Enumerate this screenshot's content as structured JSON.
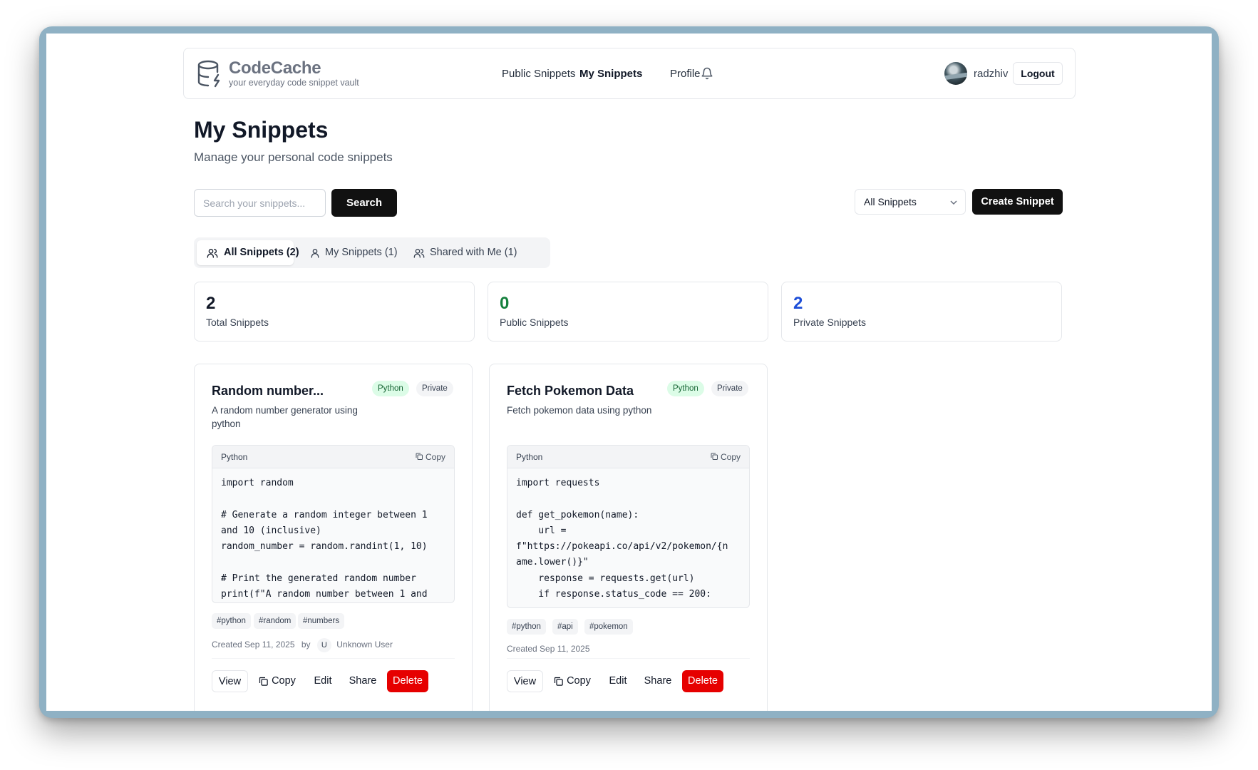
{
  "app": {
    "name": "CodeCache",
    "tagline": "your everyday code snippet vault"
  },
  "nav": {
    "links": [
      "Public Snippets",
      "My Snippets",
      "Profile"
    ],
    "active": "My Snippets",
    "username": "radzhiv",
    "logout_label": "Logout"
  },
  "header": {
    "title": "My Snippets",
    "subtitle": "Manage your personal code snippets"
  },
  "toolbar": {
    "search_placeholder": "Search your snippets...",
    "search_label": "Search",
    "filter_value": "All Snippets",
    "create_label": "Create Snippet"
  },
  "tabs": [
    {
      "label": "All Snippets (2)",
      "active": true
    },
    {
      "label": "My Snippets (1)",
      "active": false
    },
    {
      "label": "Shared with Me (1)",
      "active": false
    }
  ],
  "stats": [
    {
      "value": "2",
      "label": "Total Snippets",
      "color": "#111827"
    },
    {
      "value": "0",
      "label": "Public Snippets",
      "color": "#15803d"
    },
    {
      "value": "2",
      "label": "Private Snippets",
      "color": "#1d4ed8"
    }
  ],
  "snippets": [
    {
      "title": "Random number...",
      "language": "Python",
      "visibility": "Private",
      "description": "A random number generator using python",
      "code_language": "Python",
      "copy_label": "Copy",
      "code": "import random\n\n# Generate a random integer between 1\nand 10 (inclusive)\nrandom_number = random.randint(1, 10)\n\n# Print the generated random number\nprint(f\"A random number between 1 and",
      "tags": [
        "#python",
        "#random",
        "#numbers"
      ],
      "created": "Created Sep 11, 2025",
      "by_label": "by",
      "author_initial": "U",
      "author": "Unknown User",
      "actions": {
        "view": "View",
        "copy": "Copy",
        "edit": "Edit",
        "share": "Share",
        "delete": "Delete"
      }
    },
    {
      "title": "Fetch Pokemon Data",
      "language": "Python",
      "visibility": "Private",
      "description": "Fetch pokemon data using python",
      "code_language": "Python",
      "copy_label": "Copy",
      "code": "import requests\n\ndef get_pokemon(name):\n    url =\nf\"https://pokeapi.co/api/v2/pokemon/{n\name.lower()}\"\n    response = requests.get(url)\n    if response.status_code == 200:",
      "tags": [
        "#python",
        "#api",
        "#pokemon"
      ],
      "created": "Created Sep 11, 2025",
      "actions": {
        "view": "View",
        "copy": "Copy",
        "edit": "Edit",
        "share": "Share",
        "delete": "Delete"
      }
    }
  ]
}
